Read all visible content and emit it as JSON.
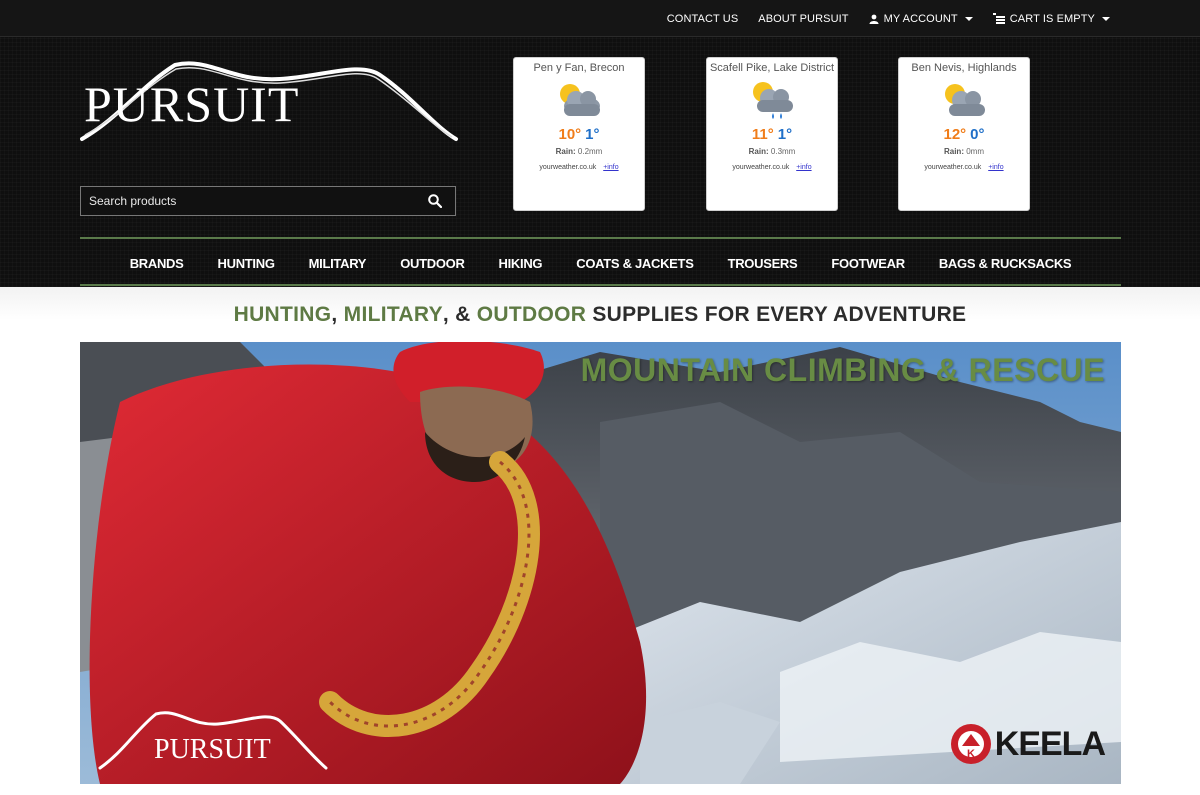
{
  "topnav": {
    "contact": "CONTACT US",
    "about": "ABOUT PURSUIT",
    "account": "MY ACCOUNT",
    "cart": "CART IS EMPTY"
  },
  "brand": {
    "name": "PURSUIT"
  },
  "search": {
    "placeholder": "Search products"
  },
  "weather": [
    {
      "location": "Pen y Fan, Brecon",
      "high": "10°",
      "low": "1°",
      "rain_label": "Rain:",
      "rain": "0.2mm",
      "source": "yourweather.co.uk",
      "more": "+info",
      "icon": "sun-cloud-icon"
    },
    {
      "location": "Scafell Pike, Lake District",
      "high": "11°",
      "low": "1°",
      "rain_label": "Rain:",
      "rain": "0.3mm",
      "source": "yourweather.co.uk",
      "more": "+info",
      "icon": "sun-cloud-rain-icon"
    },
    {
      "location": "Ben Nevis, Highlands",
      "high": "12°",
      "low": "0°",
      "rain_label": "Rain:",
      "rain": "0mm",
      "source": "yourweather.co.uk",
      "more": "+info",
      "icon": "sun-cloud-icon"
    }
  ],
  "mainnav": [
    "BRANDS",
    "HUNTING",
    "MILITARY",
    "OUTDOOR",
    "HIKING",
    "COATS & JACKETS",
    "TROUSERS",
    "FOOTWEAR",
    "BAGS & RUCKSACKS"
  ],
  "tagline": {
    "w1": "HUNTING",
    "s1": ", ",
    "w2": "MILITARY",
    "s2": ", & ",
    "w3": "OUTDOOR",
    "rest": " SUPPLIES FOR EVERY ADVENTURE"
  },
  "hero": {
    "title": "MOUNTAIN CLIMBING & RESCUE",
    "logo_text": "PURSUIT",
    "brand": "KEELA"
  },
  "colors": {
    "accent_green": "#5e7a44",
    "temp_high": "#f07d1a",
    "temp_low": "#1f6fc8",
    "jacket_red": "#c8202a"
  }
}
